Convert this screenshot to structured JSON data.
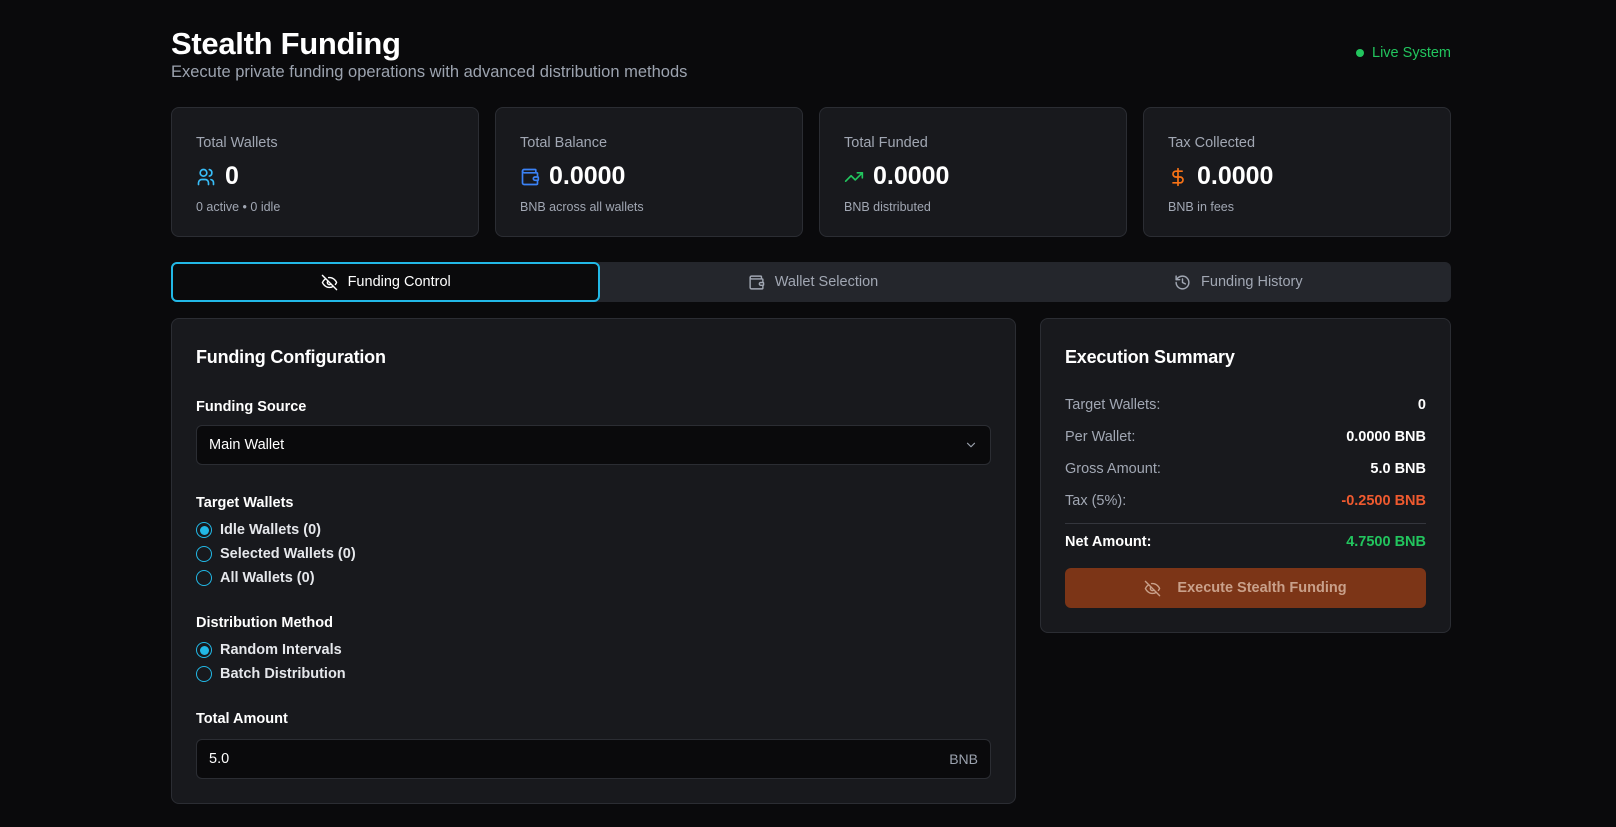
{
  "header": {
    "title": "Stealth Funding",
    "subtitle": "Execute private funding operations with advanced distribution methods",
    "status": "Live System",
    "status_color": "#22c55e"
  },
  "stats": [
    {
      "label": "Total Wallets",
      "value": "0",
      "sub": "0 active • 0 idle",
      "icon": "users-icon",
      "icon_color": "#38bdf8"
    },
    {
      "label": "Total Balance",
      "value": "0.0000",
      "sub": "BNB across all wallets",
      "icon": "wallet-icon",
      "icon_color": "#3b82f6"
    },
    {
      "label": "Total Funded",
      "value": "0.0000",
      "sub": "BNB distributed",
      "icon": "trending-up-icon",
      "icon_color": "#22c55e"
    },
    {
      "label": "Tax Collected",
      "value": "0.0000",
      "sub": "BNB in fees",
      "icon": "dollar-icon",
      "icon_color": "#f97316"
    }
  ],
  "tabs": [
    {
      "label": "Funding Control",
      "icon": "eye-off-icon",
      "active": true
    },
    {
      "label": "Wallet Selection",
      "icon": "wallet-icon",
      "active": false
    },
    {
      "label": "Funding History",
      "icon": "history-icon",
      "active": false
    }
  ],
  "config": {
    "title": "Funding Configuration",
    "source_label": "Funding Source",
    "source_value": "Main Wallet",
    "target_label": "Target Wallets",
    "target_options": [
      "Idle Wallets (0)",
      "Selected Wallets (0)",
      "All Wallets (0)"
    ],
    "target_selected": 0,
    "method_label": "Distribution Method",
    "method_options": [
      "Random Intervals",
      "Batch Distribution"
    ],
    "method_selected": 0,
    "amount_label": "Total Amount",
    "amount_value": "5.0",
    "amount_unit": "BNB"
  },
  "summary": {
    "title": "Execution Summary",
    "rows": [
      {
        "label": "Target Wallets:",
        "value": "0"
      },
      {
        "label": "Per Wallet:",
        "value": "0.0000 BNB"
      },
      {
        "label": "Gross Amount:",
        "value": "5.0 BNB"
      },
      {
        "label": "Tax (5%):",
        "value": "-0.2500 BNB"
      }
    ],
    "net_label": "Net Amount:",
    "net_value": "4.7500 BNB",
    "button_label": "Execute Stealth Funding",
    "accent": "#22b8e6"
  }
}
